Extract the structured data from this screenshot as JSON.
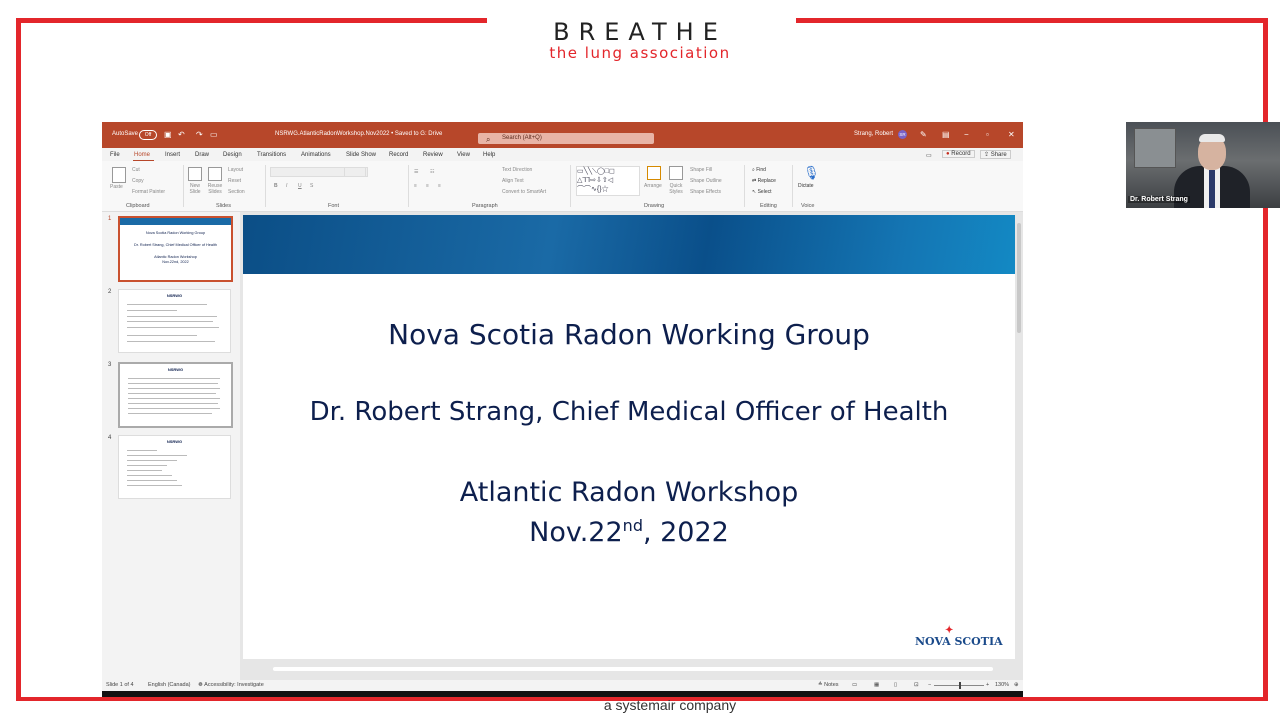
{
  "brand": {
    "name": "BREATHE",
    "tagline": "the lung association",
    "sponsor_text": "a systemair company",
    "accent_color": "#e3262b"
  },
  "ppt": {
    "titlebar": {
      "autosave_label": "AutoSave",
      "autosave_state": "Off",
      "file_title": "NSRWG.AtlanticRadonWorkshop.Nov2022 • Saved to G: Drive",
      "search_placeholder": "Search (Alt+Q)",
      "user_name": "Strang, Robert",
      "user_initials": "SR"
    },
    "menu": {
      "tabs": [
        "File",
        "Home",
        "Insert",
        "Draw",
        "Design",
        "Transitions",
        "Animations",
        "Slide Show",
        "Record",
        "Review",
        "View",
        "Help"
      ],
      "active_tab": "Home",
      "record_button": "Record",
      "share_button": "Share"
    },
    "ribbon": {
      "clipboard": {
        "paste": "Paste",
        "cut": "Cut",
        "copy": "Copy",
        "format_painter": "Format Painter",
        "group_label": "Clipboard"
      },
      "slides": {
        "new_slide": "New Slide",
        "reuse_slides": "Reuse Slides",
        "layout": "Layout",
        "reset": "Reset",
        "section": "Section",
        "group_label": "Slides"
      },
      "font": {
        "group_label": "Font"
      },
      "paragraph": {
        "text_direction": "Text Direction",
        "align_text": "Align Text",
        "convert_smartart": "Convert to SmartArt",
        "group_label": "Paragraph"
      },
      "drawing": {
        "arrange": "Arrange",
        "quick_styles": "Quick Styles",
        "shape_fill": "Shape Fill",
        "shape_outline": "Shape Outline",
        "shape_effects": "Shape Effects",
        "group_label": "Drawing"
      },
      "editing": {
        "find": "Find",
        "replace": "Replace",
        "select": "Select",
        "group_label": "Editing"
      },
      "voice": {
        "dictate": "Dictate",
        "group_label": "Voice"
      }
    },
    "thumbnails": [
      {
        "number": "1",
        "lines": [
          "Nova Scotia Radon Working Group",
          "Dr. Robert Strang, Chief Medical Officer of Health",
          "Atlantic Radon Workshop",
          "Nov.22nd, 2022"
        ]
      },
      {
        "number": "2",
        "heading": "NSRWG"
      },
      {
        "number": "3",
        "heading": "NSRWG"
      },
      {
        "number": "4",
        "heading": "NSRWG"
      }
    ],
    "slide": {
      "title": "Nova Scotia Radon Working Group",
      "presenter": "Dr. Robert Strang, Chief Medical Officer of Health",
      "event": "Atlantic Radon Workshop",
      "date_main": "Nov.22",
      "date_sup": "nd",
      "date_year": ", 2022",
      "logo_text": "NOVA SCOTIA"
    },
    "status": {
      "slide_count": "Slide 1 of 4",
      "language": "English (Canada)",
      "accessibility": "Accessibility: Investigate",
      "notes": "Notes",
      "zoom": "130%"
    }
  },
  "webcam": {
    "name_label": "Dr. Robert Strang"
  }
}
